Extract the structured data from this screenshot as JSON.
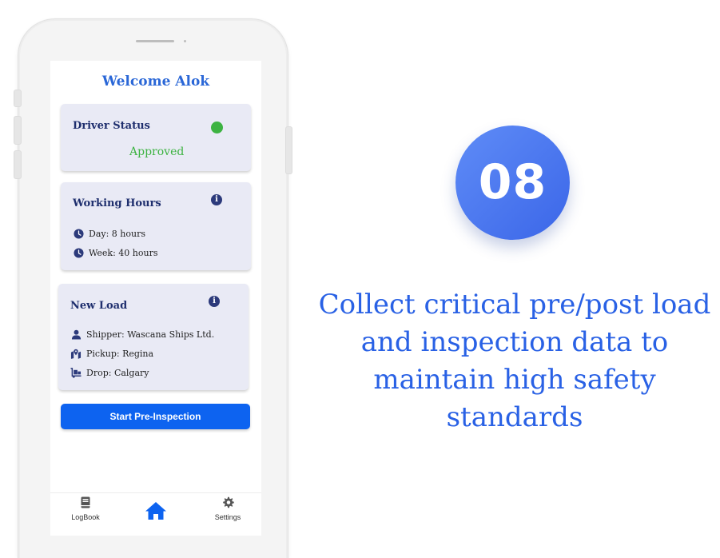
{
  "app": {
    "welcome": "Welcome Alok"
  },
  "driver_status": {
    "title": "Driver Status",
    "status": "Approved",
    "status_color": "#3db342"
  },
  "working_hours": {
    "title": "Working Hours",
    "info_icon": "info-icon",
    "rows": [
      {
        "icon": "clock-icon",
        "text": "Day: 8 hours"
      },
      {
        "icon": "clock-icon",
        "text": "Week: 40 hours"
      }
    ]
  },
  "new_load": {
    "title": "New Load",
    "info_icon": "info-icon",
    "rows": [
      {
        "icon": "person-icon",
        "text": "Shipper: Wascana Ships Ltd."
      },
      {
        "icon": "map-pin-icon",
        "text": "Pickup: Regina"
      },
      {
        "icon": "truck-loading-icon",
        "text": "Drop: Calgary"
      }
    ]
  },
  "actions": {
    "start_label": "Start Pre-Inspection"
  },
  "bottom_nav": {
    "logbook_label": "LogBook",
    "settings_label": "Settings"
  },
  "promo": {
    "step_number": "08",
    "headline_lines": [
      "Collect critical pre/post load",
      "and inspection data to",
      "maintain high safety",
      "standards"
    ]
  },
  "colors": {
    "accent": "#0d63f0",
    "title_blue": "#2a67d7",
    "card_bg": "#e9eaf5",
    "badge_gradient_start": "#5f8cf7",
    "badge_gradient_end": "#3b66e8"
  }
}
